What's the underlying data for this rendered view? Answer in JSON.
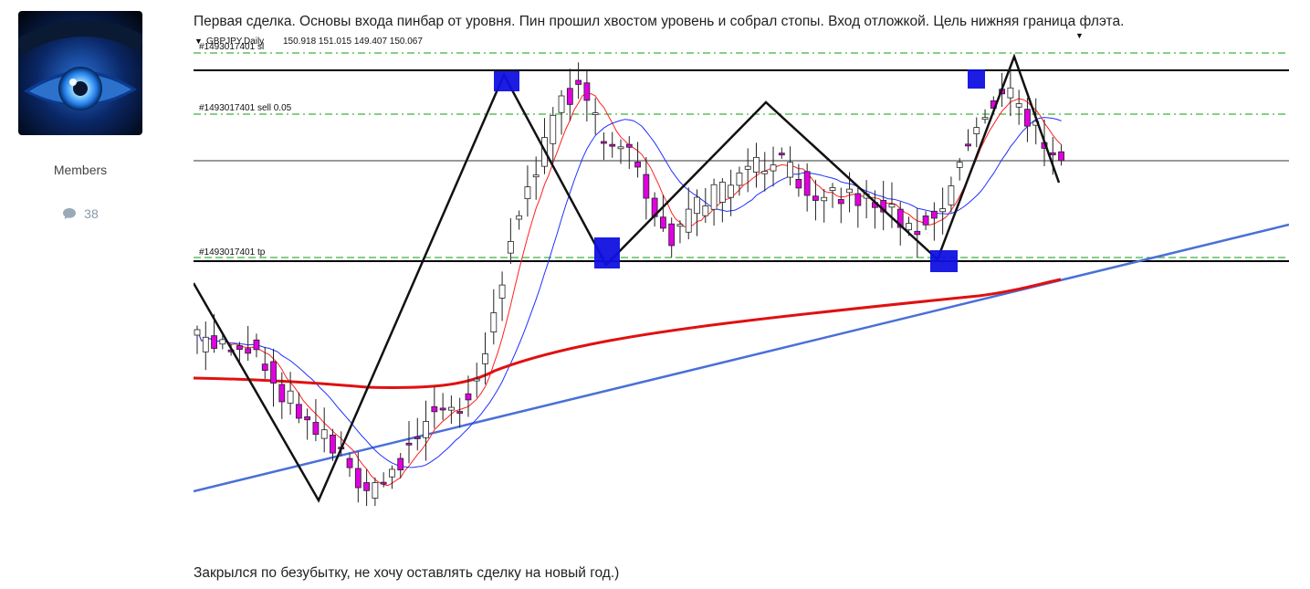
{
  "author": {
    "role": "Members",
    "post_count": "38",
    "post_count_icon": "comment-icon",
    "avatar_icon": "eye-avatar-icon"
  },
  "post": {
    "text_top": "Первая сделка. Основы входа пинбар от уровня. Пин прошил хвостом уровень и собрал стопы. Вход отложкой. Цель нижняя граница флэта.",
    "text_bottom": "Закрылся по безубытку, не хочу оставлять сделку на новый год.)"
  },
  "chart_data": {
    "type": "candlestick",
    "symbol_label": "GBPJPY,Daily",
    "ohlc_label": "150.918 151.015 149.407 150.067",
    "order_labels": {
      "sl": "#1493017401 sl",
      "sell": "#1493017401 sell 0.05",
      "tp": "#1493017401 tp"
    },
    "colors": {
      "bull": "#ffffff",
      "bear": "#e000e0",
      "wick": "#222222",
      "zigzag": "#111111",
      "marker": "#1010e0",
      "ma_fast": "#ff2020",
      "ma_mid": "#2030ff",
      "ma_slow": "#e01010",
      "trendline": "#4a6fd8",
      "order_line": "#3cb43c",
      "level": "#000000"
    }
  }
}
